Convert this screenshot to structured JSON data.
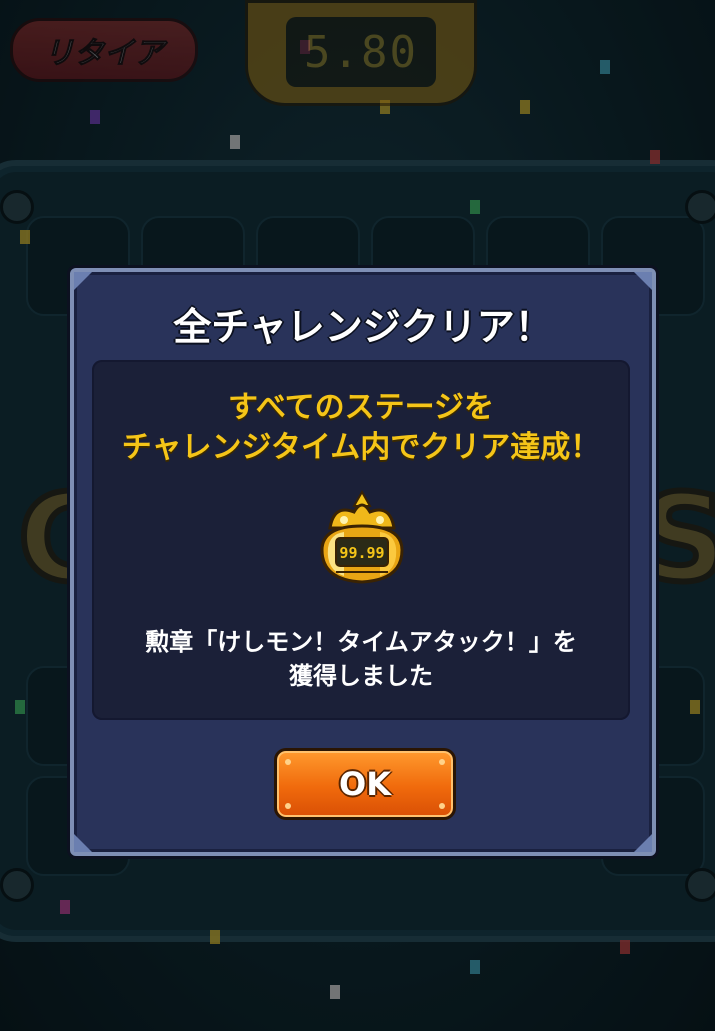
{
  "hud": {
    "retire_label": "リタイア",
    "timer_value": "5.80"
  },
  "background": {
    "word_left": "C",
    "word_right": "S"
  },
  "dialog": {
    "title": "全チャレンジクリア！",
    "message_line1": "すべてのステージを",
    "message_line2": "チャレンジタイム内でクリア達成！",
    "medal_value": "99.99",
    "reward_line1": "勲章「けしモン！タイムアタック！」を",
    "reward_line2": "獲得しました",
    "ok_label": "OK"
  },
  "colors": {
    "dialog_bg": "#29335a",
    "accent_yellow": "#f5c518",
    "ok_orange": "#f06a0c"
  }
}
